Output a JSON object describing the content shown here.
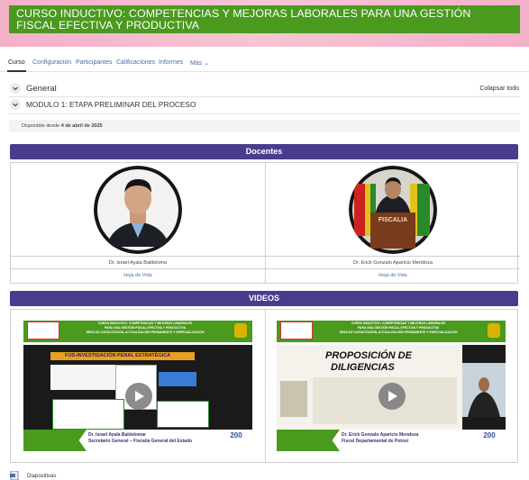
{
  "course": {
    "title": "CURSO INDUCTIVO: COMPETENCIAS Y MEJORAS LABORALES PARA UNA GESTIÓN FISCAL EFECTIVA Y PRODUCTIVA"
  },
  "tabs": [
    {
      "label": "Curso"
    },
    {
      "label": "Configuración"
    },
    {
      "label": "Participantes"
    },
    {
      "label": "Calificaciones"
    },
    {
      "label": "Informes"
    },
    {
      "label": "Más"
    }
  ],
  "sections": {
    "general": "General",
    "collapse_all": "Colapsar todo",
    "modulo": "MODULO 1: ETAPA PRELIMINAR DEL PROCESO"
  },
  "availability": {
    "prefix": "Disponible desde",
    "date": "4 de abril de 2025"
  },
  "docentes": {
    "title": "Docentes",
    "teachers": [
      {
        "name": "Dr. Israel Ayala Baldeloma",
        "cv": "Hoja de Vida"
      },
      {
        "name": "Dr. Erick Gonzalo Aparicio Mendoza",
        "cv": "Hoja de Vida"
      }
    ],
    "podium_label": "FISCALIA"
  },
  "videos": {
    "title": "VIDEOS",
    "items": [
      {
        "header_lines": [
          "CURSO INDUCTIVO: COMPETENCIAS Y MEJORAS LABORALES",
          "PARA UNA GESTIÓN FISCAL EFECTIVA Y PRODUCTIVA",
          "ÁREA DE CAPACITACIÓN, ACTUALIZACIÓN PERMANENTE Y ESPECIALIZACIÓN"
        ],
        "slide_title": "FUD-INVESTIGACIÓN PENAL ESTRATÉGICA",
        "presenter": "Dr. Israel Ayala Baldelomar",
        "role": "Secretario General – Fiscalía General del Estado",
        "logo": "200"
      },
      {
        "header_lines": [
          "CURSO INDUCTIVO: COMPETENCIAS Y MEJORAS LABORALES",
          "PARA UNA GESTIÓN FISCAL EFECTIVA Y PRODUCTIVA",
          "ÁREA DE CAPACITACIÓN, ACTUALIZACIÓN PERMANENTE Y ESPECIALIZACIÓN"
        ],
        "slide_title_1": "PROPOSICIÓN DE",
        "slide_title_2": "DILIGENCIAS",
        "presenter": "Dr. Erick Gonzalo Aparicio Mendoza",
        "role": "Fiscal Departamental de Potosí",
        "logo": "200"
      }
    ]
  },
  "resources": {
    "diapositivas": "Diapositivas"
  },
  "colors": {
    "title_green": "#4a9a1e",
    "header_pink": "#f3b0c9",
    "band_purple": "#4b3b8c",
    "link_blue": "#4a6fa5"
  }
}
